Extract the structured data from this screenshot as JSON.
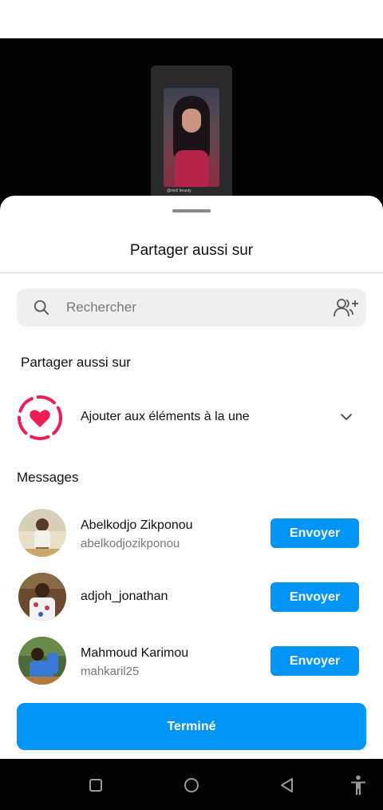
{
  "preview": {
    "caption": "@meli beauty"
  },
  "sheet": {
    "title": "Partager aussi sur"
  },
  "search": {
    "placeholder": "Rechercher",
    "icon": "search-icon",
    "add_icon": "add-people-icon"
  },
  "share_section": {
    "label": "Partager aussi sur",
    "highlight_label": "Ajouter aux éléments à la une",
    "highlight_icon": "heart-highlight-icon",
    "accent": "#ee1d52"
  },
  "messages": {
    "label": "Messages",
    "contacts": [
      {
        "name": "Abelkodjo Zikponou",
        "username": "abelkodjozikponou",
        "button": "Envoyer"
      },
      {
        "name": "adjoh_jonathan",
        "username": "",
        "button": "Envoyer"
      },
      {
        "name": "Mahmoud Karimou",
        "username": "mahkaril25",
        "button": "Envoyer"
      }
    ]
  },
  "done_button": "Terminé",
  "colors": {
    "primary": "#0095f6",
    "highlight": "#ee1d52"
  },
  "nav": {
    "icons": [
      "recents-icon",
      "home-icon",
      "back-icon",
      "accessibility-icon"
    ]
  }
}
